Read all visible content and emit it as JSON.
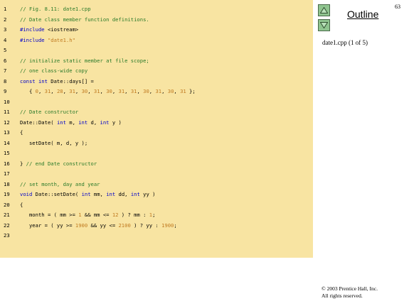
{
  "page_number": "63",
  "outline": {
    "title": "Outline",
    "file_label": "date1.cpp (1 of 5)"
  },
  "nav": {
    "up_icon": "triangle-up-icon",
    "down_icon": "triangle-down-icon"
  },
  "copyright": {
    "line1": "© 2003 Prentice Hall, Inc.",
    "line2": "All rights reserved."
  },
  "colors": {
    "panel": "#f8e4a2",
    "comment": "#2a7a2a",
    "keyword": "#0000cc",
    "literal": "#c07a20",
    "button": "#8fc48f"
  },
  "code": {
    "lines": [
      {
        "num": "1",
        "segments": [
          {
            "t": "c",
            "v": "// Fig. 8.11: date1.cpp"
          }
        ]
      },
      {
        "num": "2",
        "segments": [
          {
            "t": "c",
            "v": "// Date class member function definitions."
          }
        ]
      },
      {
        "num": "3",
        "segments": [
          {
            "t": "k",
            "v": "#include"
          },
          {
            "t": "n",
            "v": " <iostream>"
          }
        ]
      },
      {
        "num": "4",
        "segments": [
          {
            "t": "k",
            "v": "#include"
          },
          {
            "t": "n",
            "v": " "
          },
          {
            "t": "s",
            "v": "\"date1.h\""
          }
        ]
      },
      {
        "num": "5",
        "segments": []
      },
      {
        "num": "6",
        "segments": [
          {
            "t": "c",
            "v": "// initialize static member at file scope;"
          }
        ]
      },
      {
        "num": "7",
        "segments": [
          {
            "t": "c",
            "v": "// one class-wide copy"
          }
        ]
      },
      {
        "num": "8",
        "segments": [
          {
            "t": "k",
            "v": "const int"
          },
          {
            "t": "n",
            "v": " Date::days[] ="
          }
        ]
      },
      {
        "num": "9",
        "segments": [
          {
            "t": "n",
            "v": "   { "
          },
          {
            "t": "s",
            "v": "0"
          },
          {
            "t": "n",
            "v": ", "
          },
          {
            "t": "s",
            "v": "31"
          },
          {
            "t": "n",
            "v": ", "
          },
          {
            "t": "s",
            "v": "28"
          },
          {
            "t": "n",
            "v": ", "
          },
          {
            "t": "s",
            "v": "31"
          },
          {
            "t": "n",
            "v": ", "
          },
          {
            "t": "s",
            "v": "30"
          },
          {
            "t": "n",
            "v": ", "
          },
          {
            "t": "s",
            "v": "31"
          },
          {
            "t": "n",
            "v": ", "
          },
          {
            "t": "s",
            "v": "30"
          },
          {
            "t": "n",
            "v": ", "
          },
          {
            "t": "s",
            "v": "31"
          },
          {
            "t": "n",
            "v": ", "
          },
          {
            "t": "s",
            "v": "31"
          },
          {
            "t": "n",
            "v": ", "
          },
          {
            "t": "s",
            "v": "30"
          },
          {
            "t": "n",
            "v": ", "
          },
          {
            "t": "s",
            "v": "31"
          },
          {
            "t": "n",
            "v": ", "
          },
          {
            "t": "s",
            "v": "30"
          },
          {
            "t": "n",
            "v": ", "
          },
          {
            "t": "s",
            "v": "31"
          },
          {
            "t": "n",
            "v": " };"
          }
        ]
      },
      {
        "num": "10",
        "segments": []
      },
      {
        "num": "11",
        "segments": [
          {
            "t": "c",
            "v": "// Date constructor"
          }
        ]
      },
      {
        "num": "12",
        "segments": [
          {
            "t": "n",
            "v": "Date::Date( "
          },
          {
            "t": "k",
            "v": "int"
          },
          {
            "t": "n",
            "v": " m, "
          },
          {
            "t": "k",
            "v": "int"
          },
          {
            "t": "n",
            "v": " d, "
          },
          {
            "t": "k",
            "v": "int"
          },
          {
            "t": "n",
            "v": " y )"
          }
        ]
      },
      {
        "num": "13",
        "segments": [
          {
            "t": "n",
            "v": "{"
          }
        ]
      },
      {
        "num": "14",
        "segments": [
          {
            "t": "n",
            "v": "   setDate( m, d, y );"
          }
        ]
      },
      {
        "num": "15",
        "segments": []
      },
      {
        "num": "16",
        "segments": [
          {
            "t": "n",
            "v": "} "
          },
          {
            "t": "c",
            "v": "// end Date constructor"
          }
        ]
      },
      {
        "num": "17",
        "segments": []
      },
      {
        "num": "18",
        "segments": [
          {
            "t": "c",
            "v": "// set month, day and year"
          }
        ]
      },
      {
        "num": "19",
        "segments": [
          {
            "t": "k",
            "v": "void"
          },
          {
            "t": "n",
            "v": " Date::setDate( "
          },
          {
            "t": "k",
            "v": "int"
          },
          {
            "t": "n",
            "v": " mm, "
          },
          {
            "t": "k",
            "v": "int"
          },
          {
            "t": "n",
            "v": " dd, "
          },
          {
            "t": "k",
            "v": "int"
          },
          {
            "t": "n",
            "v": " yy )"
          }
        ]
      },
      {
        "num": "20",
        "segments": [
          {
            "t": "n",
            "v": "{"
          }
        ]
      },
      {
        "num": "21",
        "segments": [
          {
            "t": "n",
            "v": "   month = ( mm >= "
          },
          {
            "t": "s",
            "v": "1"
          },
          {
            "t": "n",
            "v": " && mm <= "
          },
          {
            "t": "s",
            "v": "12"
          },
          {
            "t": "n",
            "v": " ) ? mm : "
          },
          {
            "t": "s",
            "v": "1"
          },
          {
            "t": "n",
            "v": ";"
          }
        ]
      },
      {
        "num": "22",
        "segments": [
          {
            "t": "n",
            "v": "   year = ( yy >= "
          },
          {
            "t": "s",
            "v": "1900"
          },
          {
            "t": "n",
            "v": " && yy <= "
          },
          {
            "t": "s",
            "v": "2100"
          },
          {
            "t": "n",
            "v": " ) ? yy : "
          },
          {
            "t": "s",
            "v": "1900"
          },
          {
            "t": "n",
            "v": ";"
          }
        ]
      },
      {
        "num": "23",
        "segments": []
      }
    ]
  }
}
